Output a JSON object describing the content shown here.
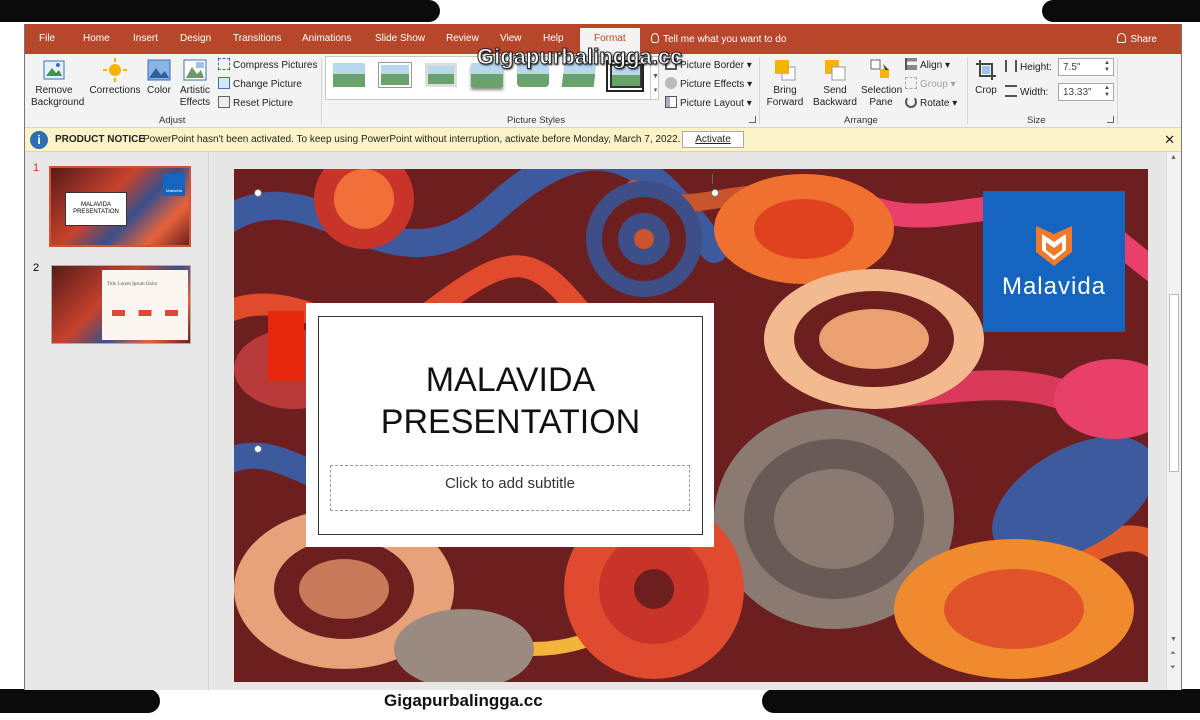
{
  "watermark_top": "Gigapurbalingga.cc",
  "watermark_bottom": "Gigapurbalingga.cc",
  "tabs": [
    "File",
    "Home",
    "Insert",
    "Design",
    "Transitions",
    "Animations",
    "Slide Show",
    "Review",
    "View",
    "Help",
    "Format"
  ],
  "active_tab": "Format",
  "tell_me": "Tell me what you want to do",
  "share": "Share",
  "ribbon": {
    "remove_background": "Remove Background",
    "corrections": "Corrections",
    "color": "Color",
    "artistic_effects": "Artistic Effects",
    "compress_pictures": "Compress Pictures",
    "change_picture": "Change Picture",
    "reset_picture": "Reset Picture",
    "adjust_label": "Adjust",
    "picture_border": "Picture Border",
    "picture_effects": "Picture Effects",
    "picture_layout": "Picture Layout",
    "picture_styles_label": "Picture Styles",
    "bring_forward": "Bring Forward",
    "send_backward": "Send Backward",
    "selection_pane": "Selection Pane",
    "align": "Align",
    "group": "Group",
    "rotate": "Rotate",
    "arrange_label": "Arrange",
    "crop": "Crop",
    "height_label": "Height:",
    "height_value": "7.5\"",
    "width_label": "Width:",
    "width_value": "13.33\"",
    "size_label": "Size"
  },
  "notice": {
    "title": "PRODUCT NOTICE",
    "message": "PowerPoint hasn't been activated. To keep using PowerPoint without interruption, activate before Monday, March 7, 2022.",
    "button": "Activate"
  },
  "slides": [
    {
      "number": "1",
      "thumb_title": "MALAVIDA PRESENTATION",
      "thumb_logo": "Malavida"
    },
    {
      "number": "2",
      "thumb_title": "Title Lorem Ipsum Dolor"
    }
  ],
  "slide": {
    "title_line1": "MALAVIDA",
    "title_line2": "PRESENTATION",
    "subtitle_placeholder": "Click to add subtitle",
    "logo_text": "Malavida"
  },
  "colors": {
    "ribbon_red": "#b7472a",
    "logo_blue": "#1565c0",
    "accent_red": "#e8280c",
    "notice_bg": "#fdf3c8"
  }
}
